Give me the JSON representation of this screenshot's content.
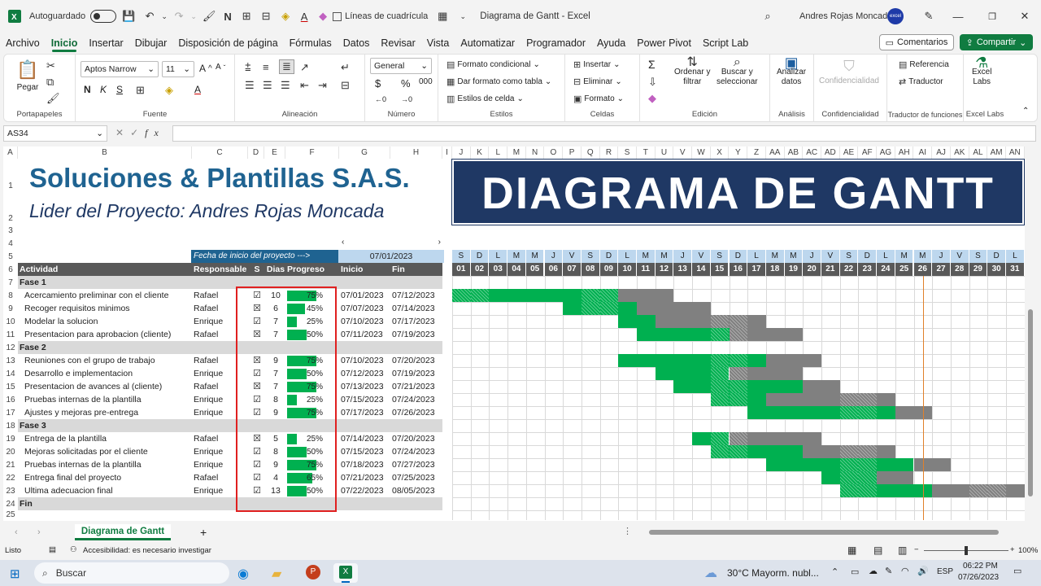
{
  "titlebar": {
    "autosave": "Autoguardado",
    "gridlines": "Líneas de cuadrícula",
    "title": "Diagrama de Gantt  -  Excel",
    "user": "Andres Rojas Moncada",
    "avatar_text": "excel"
  },
  "menu": [
    "Archivo",
    "Inicio",
    "Insertar",
    "Dibujar",
    "Disposición de página",
    "Fórmulas",
    "Datos",
    "Revisar",
    "Vista",
    "Automatizar",
    "Programador",
    "Ayuda",
    "Power Pivot",
    "Script Lab"
  ],
  "menu_active": "Inicio",
  "comments_label": "Comentarios",
  "share_label": "Compartir",
  "ribbon": {
    "paste": "Pegar",
    "group_clipboard": "Portapapeles",
    "font_name": "Aptos Narrow",
    "font_size": "11",
    "group_font": "Fuente",
    "group_align": "Alineación",
    "number_format": "General",
    "group_number": "Número",
    "cond_format": "Formato condicional",
    "table_format": "Dar formato como tabla",
    "cell_styles": "Estilos de celda",
    "group_styles": "Estilos",
    "insert": "Insertar",
    "delete": "Eliminar",
    "format": "Formato",
    "group_cells": "Celdas",
    "sort_filter_1": "Ordenar y",
    "sort_filter_2": "filtrar",
    "find_1": "Buscar y",
    "find_2": "seleccionar",
    "group_edit": "Edición",
    "analyze_1": "Analizar",
    "analyze_2": "datos",
    "group_analysis": "Análisis",
    "confidentiality": "Confidencialidad",
    "group_conf": "Confidencialidad",
    "reference": "Referencia",
    "translator": "Traductor",
    "group_trans": "Traductor de funciones",
    "labs_1": "Excel",
    "labs_2": "Labs",
    "group_labs": "Excel Labs"
  },
  "namebox": "AS34",
  "formula": "",
  "columns_left": [
    [
      "A",
      18
    ],
    [
      "B",
      214
    ],
    [
      "C",
      69
    ],
    [
      "D",
      20
    ],
    [
      "E",
      26
    ],
    [
      "F",
      66
    ],
    [
      "G",
      63
    ],
    [
      "H",
      64
    ]
  ],
  "columns_right": [
    "I",
    "J",
    "K",
    "L",
    "M",
    "N",
    "O",
    "P",
    "Q",
    "R",
    "S",
    "T",
    "U",
    "V",
    "W",
    "X",
    "Y",
    "Z",
    "AA",
    "AB",
    "AC",
    "AD",
    "AE",
    "AF",
    "AG",
    "AH",
    "AI",
    "AJ",
    "AK",
    "AL",
    "AM",
    "AN"
  ],
  "company": "Soluciones & Plantillas S.A.S.",
  "leader": "Lider del Proyecto: Andres Rojas Moncada",
  "banner": "DIAGRAMA DE GANTT",
  "start_label": "Fecha de inicio del proyecto --->",
  "start_date": "07/01/2023",
  "headers": {
    "activity": "Actividad",
    "owner": "Responsable",
    "s": "S",
    "days": "Dias",
    "progress": "Progreso",
    "start": "Inicio",
    "end": "Fin"
  },
  "weekdays": [
    "S",
    "D",
    "L",
    "M",
    "M",
    "J",
    "V",
    "S",
    "D",
    "L",
    "M",
    "M",
    "J",
    "V",
    "S",
    "D",
    "L",
    "M",
    "M",
    "J",
    "V",
    "S",
    "D",
    "L",
    "M",
    "M",
    "J",
    "V",
    "S",
    "D",
    "L"
  ],
  "daynums": [
    "01",
    "02",
    "03",
    "04",
    "05",
    "06",
    "07",
    "08",
    "09",
    "10",
    "11",
    "12",
    "13",
    "14",
    "15",
    "16",
    "17",
    "18",
    "19",
    "20",
    "21",
    "22",
    "23",
    "24",
    "25",
    "26",
    "27",
    "28",
    "29",
    "30",
    "31"
  ],
  "rows": [
    {
      "r": "7",
      "type": "phase",
      "label": "Fase 1"
    },
    {
      "r": "8",
      "type": "task",
      "label": "Acercamiento preliminar con el cliente",
      "owner": "Rafael",
      "check": "☑",
      "days": "10",
      "progress": "75%",
      "p": 0.75,
      "start": "07/01/2023",
      "end": "07/12/2023",
      "s": 1,
      "e": 12
    },
    {
      "r": "9",
      "type": "task",
      "label": "Recoger requisitos minimos",
      "owner": "Rafael",
      "check": "☒",
      "days": "6",
      "progress": "45%",
      "p": 0.45,
      "start": "07/07/2023",
      "end": "07/14/2023",
      "s": 7,
      "e": 14
    },
    {
      "r": "10",
      "type": "task",
      "label": "Modelar la solucion",
      "owner": "Enrique",
      "check": "☑",
      "days": "7",
      "progress": "25%",
      "p": 0.25,
      "start": "07/10/2023",
      "end": "07/17/2023",
      "s": 10,
      "e": 17
    },
    {
      "r": "11",
      "type": "task",
      "label": "Presentacion para aprobacion (cliente)",
      "owner": "Rafael",
      "check": "☒",
      "days": "7",
      "progress": "50%",
      "p": 0.5,
      "start": "07/11/2023",
      "end": "07/19/2023",
      "s": 11,
      "e": 19
    },
    {
      "r": "12",
      "type": "phase",
      "label": "Fase 2"
    },
    {
      "r": "13",
      "type": "task",
      "label": "Reuniones con el grupo de trabajo",
      "owner": "Rafael",
      "check": "☒",
      "days": "9",
      "progress": "75%",
      "p": 0.75,
      "start": "07/10/2023",
      "end": "07/20/2023",
      "s": 10,
      "e": 20
    },
    {
      "r": "14",
      "type": "task",
      "label": "Desarrollo e implementacion",
      "owner": "Enrique",
      "check": "☑",
      "days": "7",
      "progress": "50%",
      "p": 0.5,
      "start": "07/12/2023",
      "end": "07/19/2023",
      "s": 12,
      "e": 19
    },
    {
      "r": "15",
      "type": "task",
      "label": "Presentacion de avances al (cliente)",
      "owner": "Rafael",
      "check": "☒",
      "days": "7",
      "progress": "75%",
      "p": 0.75,
      "start": "07/13/2023",
      "end": "07/21/2023",
      "s": 13,
      "e": 21
    },
    {
      "r": "16",
      "type": "task",
      "label": "Pruebas internas de la plantilla",
      "owner": "Enrique",
      "check": "☑",
      "days": "8",
      "progress": "25%",
      "p": 0.25,
      "start": "07/15/2023",
      "end": "07/24/2023",
      "s": 15,
      "e": 24
    },
    {
      "r": "17",
      "type": "task",
      "label": "Ajustes y mejoras pre-entrega",
      "owner": "Enrique",
      "check": "☑",
      "days": "9",
      "progress": "75%",
      "p": 0.75,
      "start": "07/17/2023",
      "end": "07/26/2023",
      "s": 17,
      "e": 26
    },
    {
      "r": "18",
      "type": "phase",
      "label": "Fase 3"
    },
    {
      "r": "19",
      "type": "task",
      "label": "Entrega de la plantilla",
      "owner": "Rafael",
      "check": "☒",
      "days": "5",
      "progress": "25%",
      "p": 0.25,
      "start": "07/14/2023",
      "end": "07/20/2023",
      "s": 14,
      "e": 20
    },
    {
      "r": "20",
      "type": "task",
      "label": "Mejoras solicitadas por el cliente",
      "owner": "Enrique",
      "check": "☑",
      "days": "8",
      "progress": "50%",
      "p": 0.5,
      "start": "07/15/2023",
      "end": "07/24/2023",
      "s": 15,
      "e": 24
    },
    {
      "r": "21",
      "type": "task",
      "label": "Pruebas internas de la plantilla",
      "owner": "Enrique",
      "check": "☑",
      "days": "9",
      "progress": "75%",
      "p": 0.75,
      "start": "07/18/2023",
      "end": "07/27/2023",
      "s": 18,
      "e": 27
    },
    {
      "r": "22",
      "type": "task",
      "label": "Entrega final del proyecto",
      "owner": "Rafael",
      "check": "☑",
      "days": "4",
      "progress": "65%",
      "p": 0.65,
      "start": "07/21/2023",
      "end": "07/25/2023",
      "s": 21,
      "e": 25
    },
    {
      "r": "23",
      "type": "task",
      "label": "Ultima adecuacion final",
      "owner": "Enrique",
      "check": "☑",
      "days": "13",
      "progress": "50%",
      "p": 0.5,
      "start": "07/22/2023",
      "end": "08/05/2023",
      "s": 22,
      "e": 31
    },
    {
      "r": "24",
      "type": "phase",
      "label": "Fin"
    }
  ],
  "today_day": 26,
  "sheet_tab": "Diagrama de Gantt",
  "status": {
    "ready": "Listo",
    "accessibility": "Accesibilidad: es necesario investigar",
    "zoom": "100%"
  },
  "taskbar": {
    "search": "Buscar",
    "weather": "30°C  Mayorm. nubl...",
    "lang": "ESP",
    "time": "06:22 PM",
    "date": "07/26/2023"
  },
  "colors": {
    "green": "#00b050",
    "gray": "#808080",
    "navy": "#1f3864",
    "teal": "#1f6391",
    "blue_hdr": "#bdd7ee",
    "excel_green": "#107c41"
  }
}
